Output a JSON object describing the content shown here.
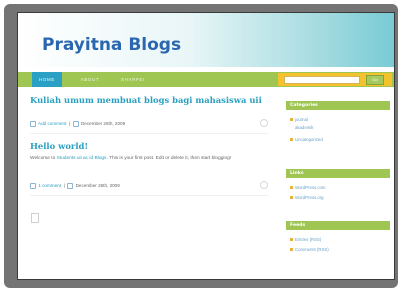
{
  "site": {
    "title": "Prayitna Blogs"
  },
  "nav": {
    "home": "HOME",
    "about": "ABOUT",
    "sharpei": "SHARPEI"
  },
  "search": {
    "placeholder": "",
    "button": "Go"
  },
  "posts": [
    {
      "title": "Kuliah umum membuat blogs bagi mahasiswa uii",
      "comments": "Add comment",
      "date": "December 26th, 2009"
    },
    {
      "title": "Hello world!",
      "body_prefix": "Welcome to ",
      "body_link": "Students uii ac id Blogs",
      "body_suffix": ". This is your first post. Edit or delete it, then start blogging!",
      "comments": "1 comment",
      "date": "December 26th, 2009"
    }
  ],
  "sidebar": {
    "categories": {
      "title": "Categories",
      "items": [
        "journal",
        "akademik",
        "Uncategorized"
      ]
    },
    "links": {
      "title": "Links",
      "items": [
        "WordPress.com",
        "WordPress.org"
      ]
    },
    "feeds": {
      "title": "Feeds",
      "items": [
        "Entries (RSS)",
        "Comments (RSS)"
      ]
    }
  },
  "colors": {
    "accent_green": "#9fc653",
    "accent_blue": "#2aa0c0",
    "title_blue": "#2b66b0",
    "search_yellow": "#f4c22d"
  }
}
